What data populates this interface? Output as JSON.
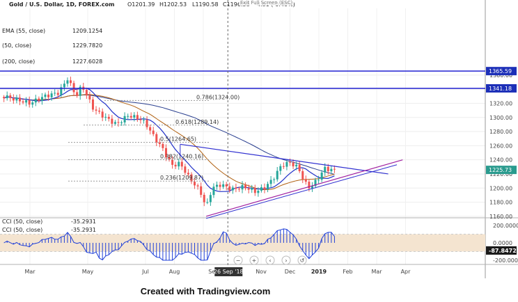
{
  "header": {
    "symbol": "Gold / U.S. Dollar, 1D, FOREX.com",
    "open": "O1201.39",
    "high": "H1202.53",
    "low": "L1190.58",
    "close": "C1196.58",
    "change": "-4.81 (-0.40%)",
    "fullscreen_hint": "Exit Full Screen (ESC)"
  },
  "legend": {
    "ema_line": "EMA (55, close)",
    "ema_value": "1209.1254",
    "ma_line2": "(50, close)",
    "ma_value2": "1229.7820",
    "ma_line3": "(200, close)",
    "ma_value3": "1227.6028"
  },
  "cci_legend": {
    "line1": "CCI (50, close)",
    "value1": "-35.2931",
    "line2": "CCI (50, close)",
    "value2": "-35.2931"
  },
  "credit": "Created with Tradingview.com",
  "colors": {
    "candle_up": "#26a69a",
    "candle_down": "#ef5350",
    "ema_fast": "#2030c8",
    "ema_mid": "#b06010",
    "ema_slow": "#2a3f8f",
    "trendline": "#3030d0",
    "support": "#a020a0",
    "cci": "#2040d8",
    "cci_band": "#f4e4d0"
  },
  "chart_data": {
    "type": "line",
    "x": [
      "2018-03-01",
      "2018-04-01",
      "2018-05-01",
      "2018-06-01",
      "2018-07-01",
      "2018-08-01",
      "2018-09-01",
      "2018-10-01",
      "2018-11-01",
      "2018-12-01"
    ],
    "series": [
      {
        "values": [
          1322,
          1335,
          1305,
          1295,
          1242,
          1212,
          1198,
          1208,
          1225,
          1226
        ]
      }
    ],
    "x_ticks": [
      "Mar",
      "May",
      "Jul",
      "Aug",
      "Sep",
      "Nov",
      "Dec",
      "2019",
      "Feb",
      "Mar",
      "Apr"
    ],
    "y_ticks": [
      1160,
      1180,
      1200,
      1220,
      1240,
      1260,
      1280,
      1300,
      1320,
      1340,
      1360
    ],
    "ylim": [
      1150,
      1380
    ],
    "price_labels": [
      {
        "value": 1365.59,
        "text": "1365.59"
      },
      {
        "value": 1341.18,
        "text": "1341.18"
      },
      {
        "value": 1225.73,
        "text": "1225.73"
      }
    ],
    "fib_levels": [
      {
        "label": "0.786(1324.00)",
        "value": 1324.0
      },
      {
        "label": "0.618(1289.14)",
        "value": 1289.14
      },
      {
        "label": "0.5(1264.65)",
        "value": 1264.65
      },
      {
        "label": "0.382(1240.16)",
        "value": 1240.16
      },
      {
        "label": "0.236(1209.87)",
        "value": 1209.87
      }
    ],
    "crosshair_date": "26 Sep '18",
    "cci_ticks": [
      200,
      0,
      -200
    ],
    "cci_tick_labels": [
      "200.0000",
      "0.0000",
      "-200.0000"
    ],
    "cci_label": {
      "value": -87.8472,
      "text": "-87.8472"
    },
    "cci_ylim": [
      -250,
      250
    ],
    "grid": true
  }
}
